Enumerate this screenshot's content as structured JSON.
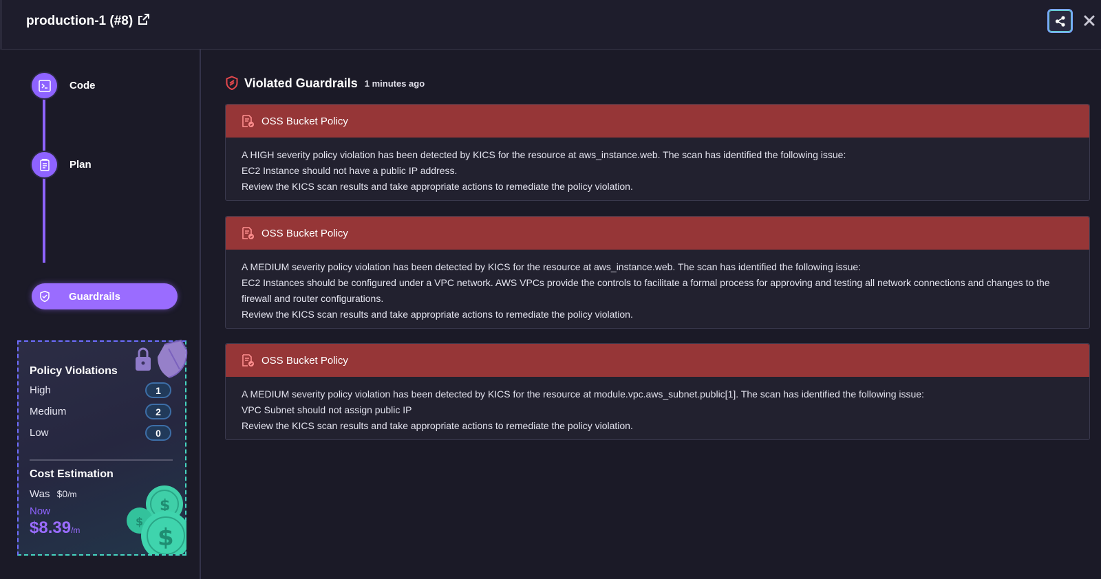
{
  "header": {
    "title": "production-1 (#8)"
  },
  "steps": [
    {
      "label": "Code"
    },
    {
      "label": "Plan"
    },
    {
      "label": "Guardrails"
    }
  ],
  "policy": {
    "title": "Policy Violations",
    "rows": [
      {
        "label": "High",
        "count": "1"
      },
      {
        "label": "Medium",
        "count": "2"
      },
      {
        "label": "Low",
        "count": "0"
      }
    ]
  },
  "cost": {
    "title": "Cost Estimation",
    "was_label": "Was",
    "was_amount": "$0",
    "was_unit": "/m",
    "now_label": "Now",
    "now_amount": "$8.39",
    "now_unit": "/m"
  },
  "main": {
    "title": "Violated Guardrails",
    "time_ago": "1 minutes ago"
  },
  "violations": [
    {
      "title": "OSS Bucket Policy",
      "lines": [
        "A HIGH severity policy violation has been detected by KICS for the resource at aws_instance.web. The scan has identified the following issue:",
        "EC2 Instance should not have a public IP address.",
        "Review the KICS scan results and take appropriate actions to remediate the policy violation."
      ]
    },
    {
      "title": "OSS Bucket Policy",
      "lines": [
        "A MEDIUM severity policy violation has been detected by KICS for the resource at aws_instance.web. The scan has identified the following issue:",
        "EC2 Instances should be configured under a VPC network. AWS VPCs provide the controls to facilitate a formal process for approving and testing all network connections and changes to the firewall and router configurations.",
        "Review the KICS scan results and take appropriate actions to remediate the policy violation."
      ]
    },
    {
      "title": "OSS Bucket Policy",
      "lines": [
        "A MEDIUM severity policy violation has been detected by KICS for the resource at module.vpc.aws_subnet.public[1]. The scan has identified the following issue:",
        "VPC Subnet should not assign public IP",
        "Review the KICS scan results and take appropriate actions to remediate the policy violation."
      ]
    }
  ],
  "colors": {
    "accent": "#9a6cff",
    "violation_header": "#963637",
    "background": "#1b1a27"
  }
}
